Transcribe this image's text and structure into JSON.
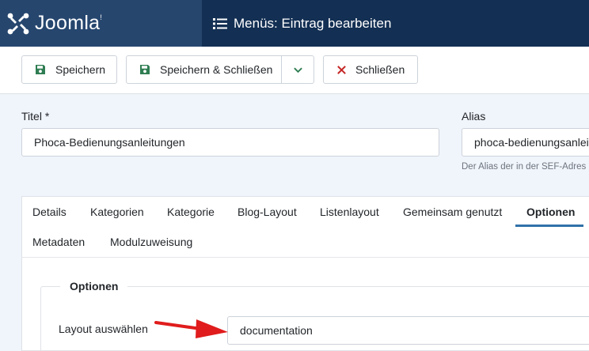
{
  "header": {
    "brand": "Joomla!",
    "brand_word": "Joomla",
    "brand_mark": "!",
    "title": "Menüs: Eintrag bearbeiten",
    "title_icon": "list-icon"
  },
  "toolbar": {
    "save_label": "Speichern",
    "save_close_label": "Speichern & Schließen",
    "close_label": "Schließen",
    "dropdown_icon": "chevron-down-icon"
  },
  "form": {
    "title_label": "Titel *",
    "title_value": "Phoca-Bedienungsanleitungen",
    "alias_label": "Alias",
    "alias_value": "phoca-bedienungsanleit",
    "alias_hint": "Der Alias der in der SEF-Adres"
  },
  "tabs": [
    {
      "label": "Details"
    },
    {
      "label": "Kategorien"
    },
    {
      "label": "Kategorie"
    },
    {
      "label": "Blog-Layout"
    },
    {
      "label": "Listenlayout"
    },
    {
      "label": "Gemeinsam genutzt"
    },
    {
      "label": "Optionen"
    },
    {
      "label": "Metadaten"
    },
    {
      "label": "Modulzuweisung"
    }
  ],
  "active_tab": "Optionen",
  "options": {
    "legend": "Optionen",
    "layout_label": "Layout auswählen",
    "layout_value": "documentation"
  },
  "colors": {
    "header_bg": "#132f53",
    "brand_bg": "#26466e",
    "save_icon": "#2f7d52",
    "close_icon": "#c52827",
    "active_tab_underline": "#3071a9",
    "annotation_arrow": "#e01c1c"
  }
}
